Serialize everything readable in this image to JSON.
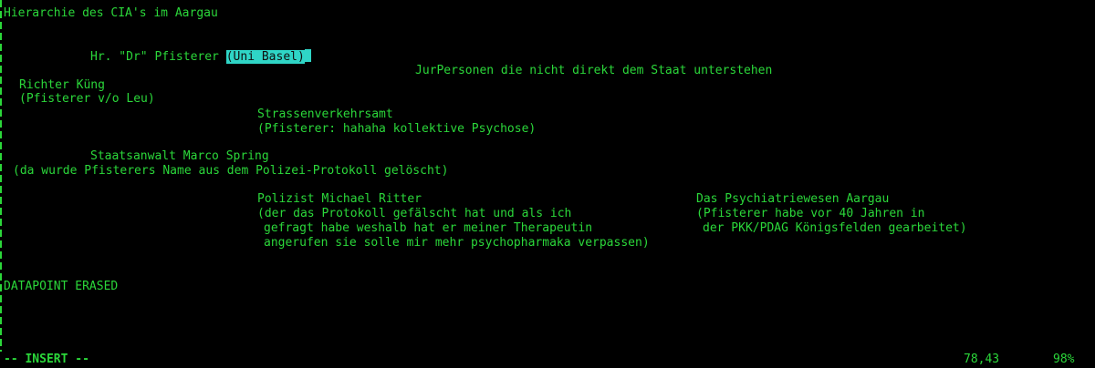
{
  "editor": {
    "title": "Hierarchie des CIA's im Aargau",
    "pfisterer_prefix": "Hr. \"Dr\" Pfisterer ",
    "pfisterer_selected_open": "(",
    "pfisterer_selected_text": "Uni Basel",
    "pfisterer_selected_close": ")",
    "jur_personen": "JurPersonen die nicht direkt dem Staat unterstehen",
    "richter_name": "Richter Küng",
    "richter_note": "(Pfisterer v/o Leu)",
    "strassen_name": "Strassenverkehrsamt",
    "strassen_note": "(Pfisterer: hahaha kollektive Psychose)",
    "staatsanwalt_name": "Staatsanwalt Marco Spring",
    "staatsanwalt_note": "(da wurde Pfisterers Name aus dem Polizei-Protokoll gelöscht)",
    "polizist_name": "Polizist Michael Ritter",
    "polizist_note_1": "(der das Protokoll gefälscht hat und als ich",
    "polizist_note_2": "gefragt habe weshalb hat er meiner Therapeutin",
    "polizist_note_3": "angerufen sie solle mir mehr psychopharmaka verpassen)",
    "psych_name": "Das Psychiatriewesen Aargau",
    "psych_note_1": "(Pfisterer habe vor 40 Jahren in",
    "psych_note_2": "der PKK/PDAG Königsfelden gearbeitet)",
    "datapoint": "DATAPOINT ERASED"
  },
  "statusbar": {
    "mode": "-- INSERT --",
    "position": "78,43",
    "percent": "98%"
  },
  "colors": {
    "background": "#000000",
    "text": "#2bd73a",
    "selection": "#2fd5c6"
  }
}
